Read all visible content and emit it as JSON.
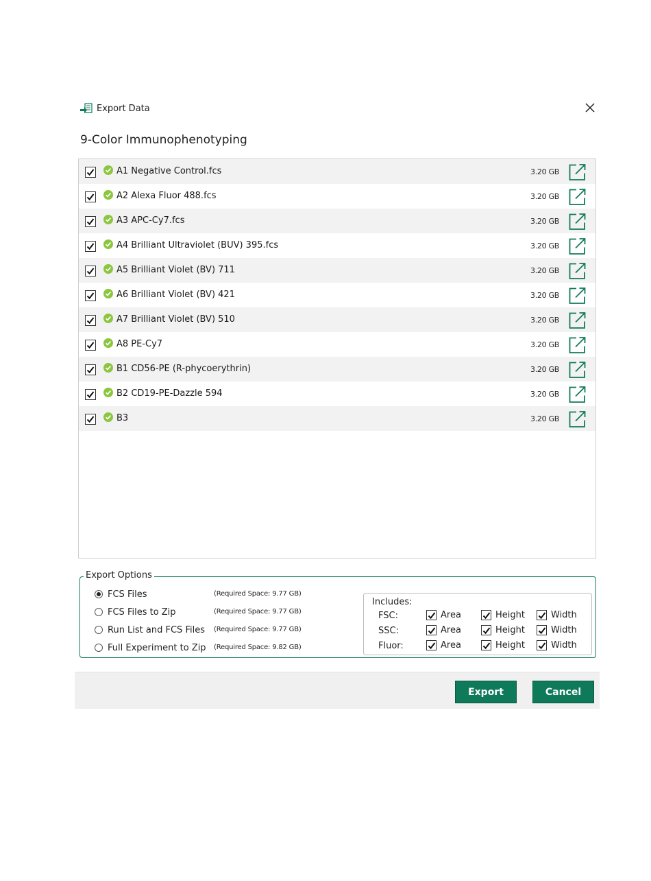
{
  "window": {
    "title": "Export Data",
    "icon": "export-data-icon",
    "close_icon": "close-icon"
  },
  "experiment_name": "9-Color Immunophenotyping",
  "files": [
    {
      "name": "A1 Negative Control.fcs",
      "size": "3.20 GB",
      "checked": true
    },
    {
      "name": "A2 Alexa Fluor 488.fcs",
      "size": "3.20 GB",
      "checked": true
    },
    {
      "name": "A3 APC-Cy7.fcs",
      "size": "3.20 GB",
      "checked": true
    },
    {
      "name": "A4 Brilliant Ultraviolet (BUV) 395.fcs",
      "size": "3.20 GB",
      "checked": true
    },
    {
      "name": "A5 Brilliant Violet (BV) 711",
      "size": "3.20 GB",
      "checked": true
    },
    {
      "name": "A6 Brilliant Violet (BV) 421",
      "size": "3.20 GB",
      "checked": true
    },
    {
      "name": "A7 Brilliant Violet (BV) 510",
      "size": "3.20 GB",
      "checked": true
    },
    {
      "name": "A8 PE-Cy7",
      "size": "3.20 GB",
      "checked": true
    },
    {
      "name": "B1 CD56-PE (R-phycoerythrin)",
      "size": "3.20 GB",
      "checked": true
    },
    {
      "name": "B2 CD19-PE-Dazzle 594",
      "size": "3.20 GB",
      "checked": true
    },
    {
      "name": "B3",
      "size": "3.20 GB",
      "checked": true
    }
  ],
  "export_options": {
    "legend": "Export Options",
    "options": [
      {
        "label": "FCS Files",
        "required": "(Required Space: 9.77 GB)",
        "selected": true
      },
      {
        "label": "FCS Files to Zip",
        "required": "(Required Space: 9.77 GB)",
        "selected": false
      },
      {
        "label": "Run List and FCS Files",
        "required": "(Required Space: 9.77 GB)",
        "selected": false
      },
      {
        "label": "Full Experiment to Zip",
        "required": "(Required Space: 9.82 GB)",
        "selected": false
      }
    ],
    "includes": {
      "title": "Includes:",
      "rows": [
        {
          "label": "FSC:",
          "items": [
            {
              "label": "Area",
              "checked": true
            },
            {
              "label": "Height",
              "checked": true
            },
            {
              "label": "Width",
              "checked": true
            }
          ]
        },
        {
          "label": "SSC:",
          "items": [
            {
              "label": "Area",
              "checked": true
            },
            {
              "label": "Height",
              "checked": true
            },
            {
              "label": "Width",
              "checked": true
            }
          ]
        },
        {
          "label": "Fluor:",
          "items": [
            {
              "label": "Area",
              "checked": true
            },
            {
              "label": "Height",
              "checked": true
            },
            {
              "label": "Width",
              "checked": true
            }
          ]
        }
      ]
    }
  },
  "buttons": {
    "export": "Export",
    "cancel": "Cancel"
  },
  "colors": {
    "accent": "#0f7a5a",
    "success": "#8cc63f",
    "row_alt": "#f2f2f2",
    "footer": "#f0f0f0"
  }
}
